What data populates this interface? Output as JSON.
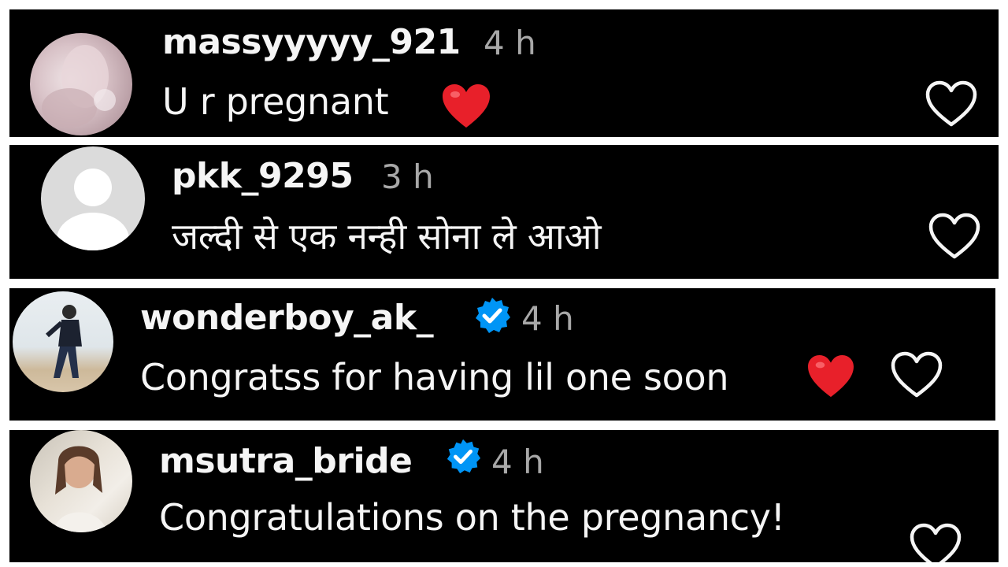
{
  "colors": {
    "card_bg": "#000000",
    "username": "#f5f5f5",
    "comment_text": "#f5f5f5",
    "timestamp": "#a8a8a8",
    "verified_badge": "#0095f6",
    "heart_emoji": "#e8202a",
    "like_icon": "#f5f5f5"
  },
  "comments": [
    {
      "username": "massyyyyy_921",
      "time": "4 h",
      "text": "U r pregnant",
      "verified": false,
      "emoji": "heart-emoji",
      "avatar": "profile-photo"
    },
    {
      "username": "pkk_9295",
      "time": "3 h",
      "text": "जल्दी से एक नन्ही सोना ले आओ",
      "verified": false,
      "emoji": "",
      "avatar": "default-avatar-icon"
    },
    {
      "username": "wonderboy_ak_",
      "time": "4 h",
      "text": "Congratss for having lil one soon",
      "verified": true,
      "emoji": "heart-emoji",
      "avatar": "profile-photo"
    },
    {
      "username": "msutra_bride",
      "time": "4 h",
      "text": "Congratulations on the pregnancy!",
      "verified": true,
      "emoji": "",
      "avatar": "profile-photo"
    }
  ]
}
